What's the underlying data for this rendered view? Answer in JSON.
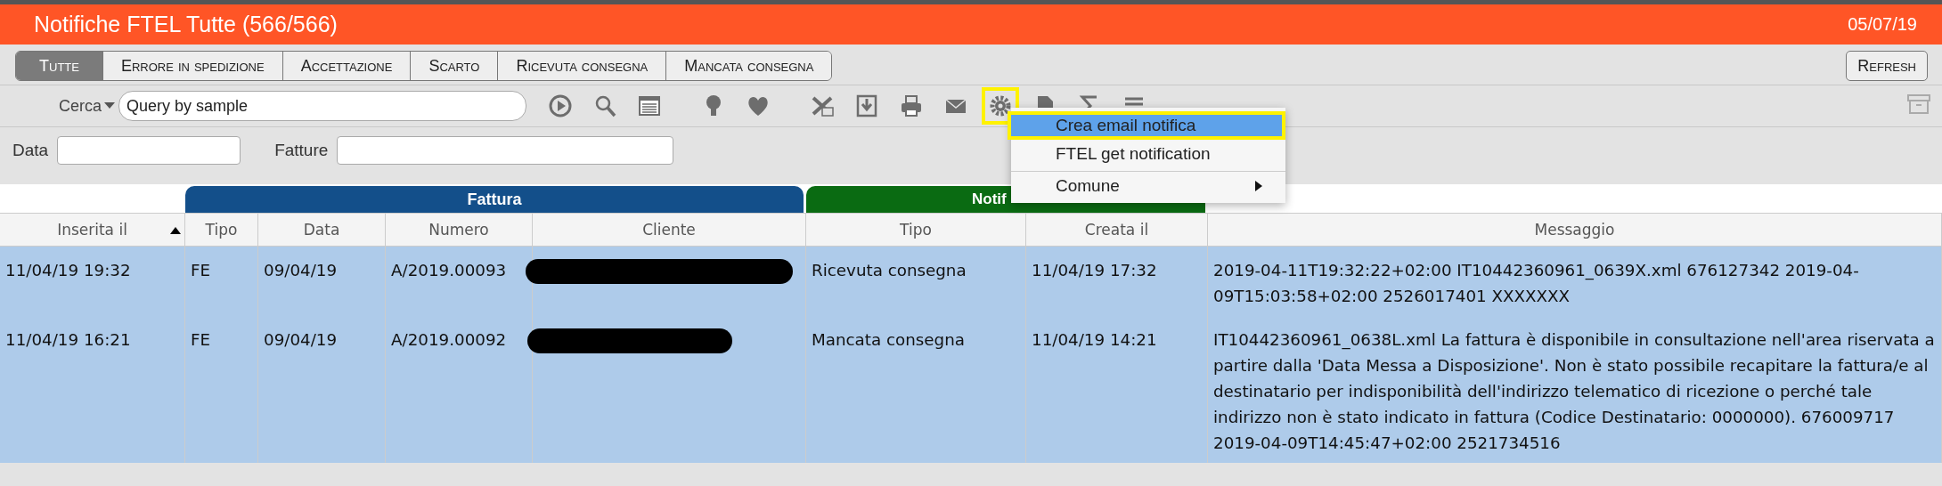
{
  "window": {
    "title": "Notifiche FTEL Tutte (566/566)",
    "date": "05/07/19"
  },
  "tabs": [
    {
      "label": "Tutte",
      "selected": true
    },
    {
      "label": "Errore in spedizione",
      "selected": false
    },
    {
      "label": "Accettazione",
      "selected": false
    },
    {
      "label": "Scarto",
      "selected": false
    },
    {
      "label": "Ricevuta consegna",
      "selected": false
    },
    {
      "label": "Mancata consegna",
      "selected": false
    }
  ],
  "refresh_button": "Refresh",
  "search": {
    "label": "Cerca",
    "placeholder": "Query by sample"
  },
  "toolbar": {
    "groups": [
      [
        {
          "kind": "play",
          "highlighted": false
        },
        {
          "kind": "search",
          "highlighted": false
        },
        {
          "kind": "list",
          "highlighted": false
        }
      ],
      [
        {
          "kind": "bulb",
          "highlighted": false
        },
        {
          "kind": "heart",
          "highlighted": false
        }
      ],
      [
        {
          "kind": "excel",
          "highlighted": false
        },
        {
          "kind": "download",
          "highlighted": false
        },
        {
          "kind": "print",
          "highlighted": false
        },
        {
          "kind": "mail",
          "highlighted": false
        },
        {
          "kind": "gear",
          "highlighted": true
        },
        {
          "kind": "document",
          "highlighted": false
        },
        {
          "kind": "sigma",
          "highlighted": false
        },
        {
          "kind": "lines",
          "highlighted": false
        }
      ]
    ]
  },
  "filters": [
    {
      "label": "Data"
    },
    {
      "label": "Fatture"
    }
  ],
  "menu": {
    "items": [
      {
        "label": "Crea email notifica",
        "selected": true,
        "separator_before": false,
        "submenu": false
      },
      {
        "label": "FTEL get notification",
        "selected": false,
        "separator_before": false,
        "submenu": false
      },
      {
        "label": "Comune",
        "selected": false,
        "separator_before": true,
        "submenu": true
      }
    ]
  },
  "table": {
    "column_groups": [
      {
        "columns": [
          {
            "label": "Inserita il",
            "sorted": true
          }
        ]
      },
      {
        "label": "Fattura",
        "color": "#134f8a",
        "columns": [
          {
            "label": "Tipo",
            "sorted": false
          },
          {
            "label": "Data",
            "sorted": false
          },
          {
            "label": "Numero",
            "sorted": false
          },
          {
            "label": "Cliente",
            "sorted": false
          }
        ]
      },
      {
        "label": "Notif",
        "color": "#0a6b12",
        "columns": [
          {
            "label": "Tipo",
            "sorted": false
          },
          {
            "label": "Creata il",
            "sorted": false
          }
        ]
      },
      {
        "columns": [
          {
            "label": "Messaggio",
            "sorted": false
          }
        ]
      }
    ],
    "rows": [
      {
        "selected": true,
        "cells": [
          {
            "text": "11/04/19 19:32"
          },
          {
            "text": "FE"
          },
          {
            "text": "09/04/19"
          },
          {
            "text": "A/2019.00093"
          },
          {
            "redacted": true
          },
          {
            "text": "Ricevuta consegna"
          },
          {
            "text": "11/04/19 17:32"
          },
          {
            "text": "2019-04-11T19:32:22+02:00 IT10442360961_0639X.xml 676127342 2019-04-09T15:03:58+02:00 2526017401 XXXXXXX"
          }
        ]
      },
      {
        "selected": true,
        "cells": [
          {
            "text": "11/04/19 16:21"
          },
          {
            "text": "FE"
          },
          {
            "text": "09/04/19"
          },
          {
            "text": "A/2019.00092"
          },
          {
            "redacted": true
          },
          {
            "text": "Mancata consegna"
          },
          {
            "text": "11/04/19 14:21"
          },
          {
            "text": "IT10442360961_0638L.xml La fattura è disponibile in consultazione nell'area riservata a partire dalla 'Data Messa a Disposizione'. Non è stato possibile recapitare la fattura/e al destinatario per indisponibilità dell'indirizzo telematico di ricezione o perché tale indirizzo non è stato indicato in fattura (Codice Destinatario: 0000000). 676009717 2019-04-09T14:45:47+02:00 2521734516"
          }
        ]
      }
    ]
  }
}
